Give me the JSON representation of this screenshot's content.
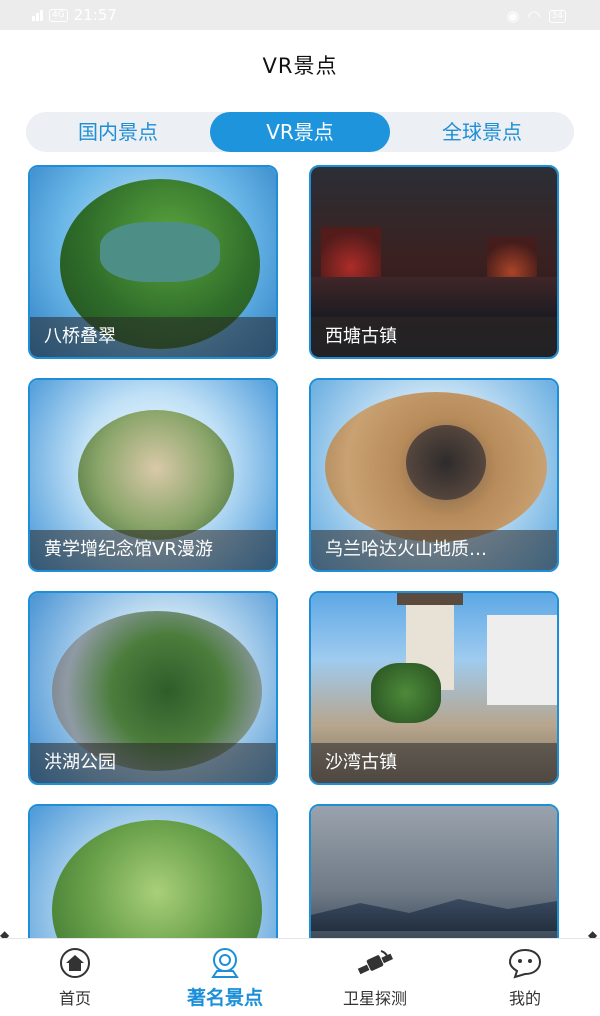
{
  "status": {
    "time": "21:57",
    "battery": "34",
    "network": "4G"
  },
  "header": {
    "title": "VR景点"
  },
  "tabs": [
    {
      "label": "国内景点",
      "active": false
    },
    {
      "label": "VR景点",
      "active": true
    },
    {
      "label": "全球景点",
      "active": false
    }
  ],
  "spots": [
    {
      "name": "八桥叠翠"
    },
    {
      "name": "西塘古镇"
    },
    {
      "name": "黄学增纪念馆VR漫游"
    },
    {
      "name": "乌兰哈达火山地质…"
    },
    {
      "name": "洪湖公园"
    },
    {
      "name": "沙湾古镇"
    },
    {
      "name": ""
    },
    {
      "name": ""
    }
  ],
  "bottom_nav": [
    {
      "label": "首页",
      "icon": "home-icon",
      "active": false
    },
    {
      "label": "著名景点",
      "icon": "camera-icon",
      "active": true
    },
    {
      "label": "卫星探测",
      "icon": "satellite-icon",
      "active": false
    },
    {
      "label": "我的",
      "icon": "chat-face-icon",
      "active": false
    }
  ],
  "colors": {
    "accent": "#1d94dc",
    "tab_bg": "#eceff3"
  }
}
